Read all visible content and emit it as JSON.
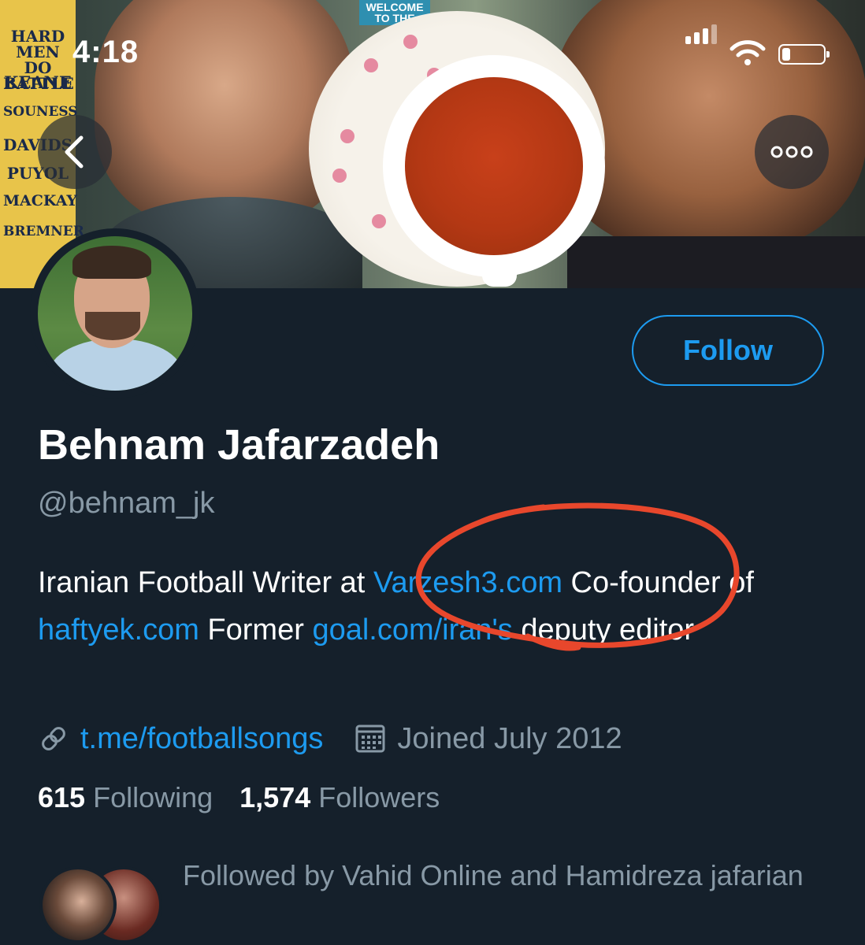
{
  "status_bar": {
    "time": "4:18"
  },
  "banner": {
    "magazine_strip": {
      "header": "HARD MEN DO BATTLE",
      "names": [
        "KEANE",
        "SOUNESS",
        "DAVIDS",
        "PUYOL",
        "MACKAY",
        "BREMNER"
      ]
    },
    "magazine_fragment": "WELCOME TO THE"
  },
  "header": {
    "back_icon": "chevron-left-icon",
    "more_icon": "more-horizontal-icon"
  },
  "profile": {
    "follow_label": "Follow",
    "name": "Behnam Jafarzadeh",
    "handle": "@behnam_jk",
    "bio": {
      "text_1": "Iranian Football Writer at ",
      "link_1": "Varzesh3.com",
      "text_2": " Co-founder of ",
      "link_2": "haftyek.com",
      "text_3": " Former ",
      "link_3": "goal.com/iran's",
      "text_4": " deputy editor"
    },
    "website": "t.me/footballsongs",
    "joined": "Joined July 2012",
    "following_count": "615",
    "following_label": "Following",
    "followers_count": "1,574",
    "followers_label": "Followers",
    "followed_by": "Followed by Vahid Online and Hamidreza jafarian"
  },
  "colors": {
    "background": "#15202b",
    "accent": "#1d9bf0",
    "secondary_text": "#8899a6",
    "annotation": "#e8472c"
  }
}
